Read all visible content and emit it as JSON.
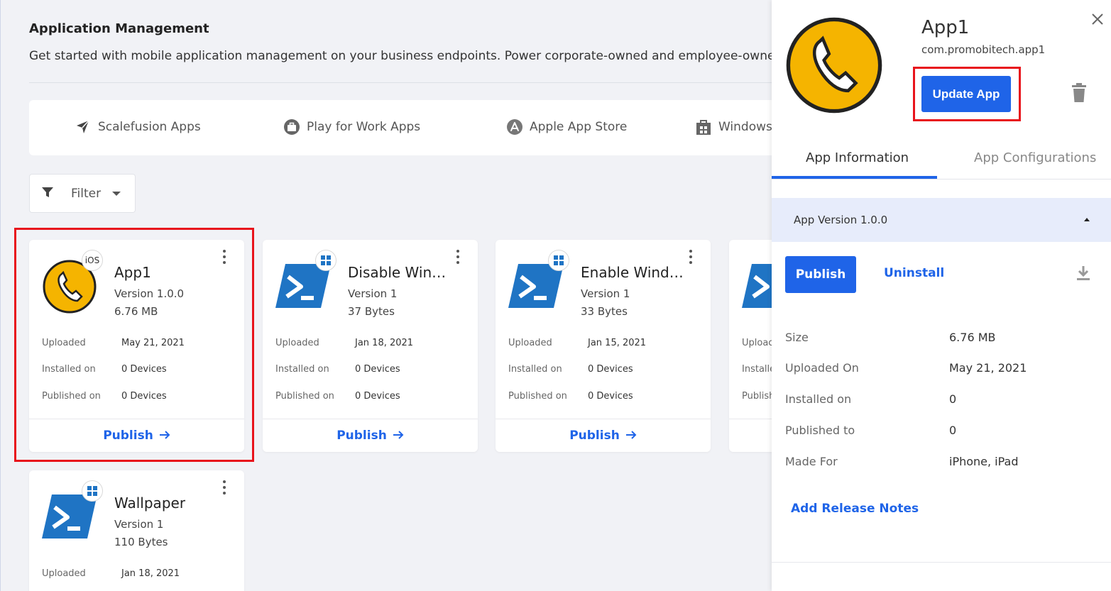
{
  "page": {
    "title": "Application Management",
    "description": "Get started with mobile application management on your business endpoints. Power corporate-owned and employee-owned"
  },
  "store_tabs": [
    {
      "label": "Scalefusion Apps",
      "icon": "scalefusion-icon"
    },
    {
      "label": "Play for Work Apps",
      "icon": "briefcase-icon"
    },
    {
      "label": "Apple App Store",
      "icon": "app-store-icon"
    },
    {
      "label": "Windows",
      "icon": "windows-store-icon"
    }
  ],
  "filter": {
    "label": "Filter"
  },
  "card_fields": {
    "uploaded": "Uploaded",
    "installed": "Installed on",
    "published": "Published on"
  },
  "cards": [
    {
      "name": "App1",
      "version": "Version 1.0.0",
      "size": "6.76 MB",
      "platform": "iOS",
      "uploaded": "May 21, 2021",
      "installed": "0 Devices",
      "published": "0 Devices",
      "action": "Publish"
    },
    {
      "name": "Disable Win…",
      "version": "Version 1",
      "size": "37 Bytes",
      "platform": "windows",
      "uploaded": "Jan 18, 2021",
      "installed": "0 Devices",
      "published": "0 Devices",
      "action": "Publish"
    },
    {
      "name": "Enable Wind…",
      "version": "Version 1",
      "size": "33 Bytes",
      "platform": "windows",
      "uploaded": "Jan 15, 2021",
      "installed": "0 Devices",
      "published": "0 Devices",
      "action": "Publish"
    },
    {
      "name": "",
      "version": "",
      "size": "",
      "platform": "windows",
      "uploaded": "",
      "installed": "",
      "published": "",
      "action": "",
      "partial_labels": {
        "uploaded": "Uploac",
        "installed": "Installe",
        "published": "Publish"
      }
    },
    {
      "name": "Wallpaper",
      "version": "Version 1",
      "size": "110 Bytes",
      "platform": "windows",
      "uploaded": "Jan 18, 2021"
    }
  ],
  "panel": {
    "app_name": "App1",
    "bundle_id": "com.promobitech.app1",
    "update_button": "Update App",
    "tabs": [
      {
        "label": "App Information",
        "active": true
      },
      {
        "label": "App Configurations",
        "active": false
      }
    ],
    "version_header": "App Version 1.0.0",
    "publish_button": "Publish",
    "uninstall_link": "Uninstall",
    "info": [
      {
        "label": "Size",
        "value": "6.76 MB"
      },
      {
        "label": "Uploaded On",
        "value": "May 21, 2021"
      },
      {
        "label": "Installed on",
        "value": "0"
      },
      {
        "label": "Published to",
        "value": "0"
      },
      {
        "label": "Made For",
        "value": "iPhone, iPad"
      }
    ],
    "release_notes_link": "Add Release Notes"
  },
  "colors": {
    "accent": "#1f64e8",
    "highlight": "#e8141c",
    "app_logo": "#f5b400",
    "powershell": "#1f74c4"
  }
}
